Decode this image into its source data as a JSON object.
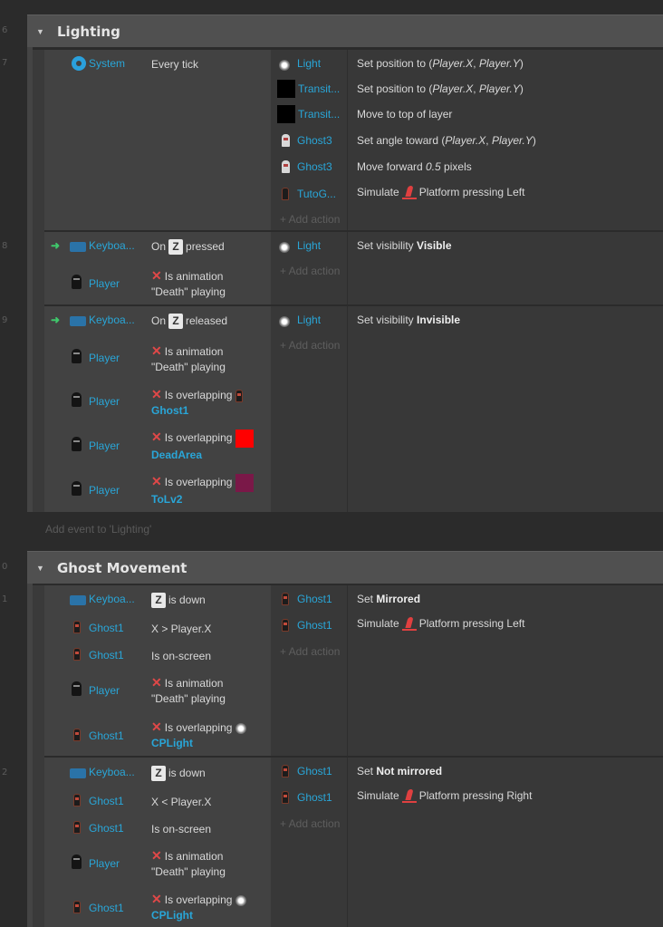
{
  "line_numbers": [
    "6",
    "7",
    "8",
    "9",
    "0",
    "1",
    "2"
  ],
  "groups": [
    {
      "title": "Lighting"
    },
    {
      "title": "Ghost Movement"
    }
  ],
  "add_event_label": "Add event to 'Lighting'",
  "add_action_label": "+ Add action",
  "events": {
    "e7": {
      "conds": [
        {
          "object": "System",
          "text": "Every tick"
        }
      ],
      "actions": [
        {
          "object": "Light",
          "text_html": "Set position to (<i>Player.X</i>, <i>Player.Y</i>)"
        },
        {
          "object": "Transit...",
          "text_html": "Set position to (<i>Player.X</i>, <i>Player.Y</i>)"
        },
        {
          "object": "Transit...",
          "text_html": "Move to top of layer"
        },
        {
          "object": "Ghost3",
          "text_html": "Set angle toward (<i>Player.X</i>, <i>Player.Y</i>)"
        },
        {
          "object": "Ghost3",
          "text_html": "Move forward <i>0.5</i> pixels"
        },
        {
          "object": "TutoG...",
          "pre": "Simulate",
          "post": "Platform pressing Left"
        }
      ]
    },
    "e8": {
      "conds": [
        {
          "object": "Keyboa...",
          "pre": "On",
          "key": "Z",
          "post": "pressed"
        },
        {
          "object": "Player",
          "line1": "Is animation",
          "line2": "\"Death\" playing"
        }
      ],
      "actions": [
        {
          "object": "Light",
          "pre": "Set visibility",
          "bold": "Visible"
        }
      ]
    },
    "e9": {
      "conds": [
        {
          "object": "Keyboa...",
          "pre": "On",
          "key": "Z",
          "post": "released"
        },
        {
          "object": "Player",
          "line1": "Is animation",
          "line2": "\"Death\" playing"
        },
        {
          "object": "Player",
          "line1": "Is overlapping",
          "line2": "Ghost1"
        },
        {
          "object": "Player",
          "line1": "Is overlapping",
          "line2": "DeadArea"
        },
        {
          "object": "Player",
          "line1": "Is overlapping",
          "line2": "ToLv2"
        }
      ],
      "actions": [
        {
          "object": "Light",
          "pre": "Set visibility",
          "bold": "Invisible"
        }
      ]
    },
    "e1": {
      "conds": [
        {
          "object": "Keyboa...",
          "key": "Z",
          "post": "is down"
        },
        {
          "object": "Ghost1",
          "text": "X > Player.X"
        },
        {
          "object": "Ghost1",
          "text": "Is on-screen"
        },
        {
          "object": "Player",
          "line1": "Is animation",
          "line2": "\"Death\" playing"
        },
        {
          "object": "Ghost1",
          "line1": "Is overlapping",
          "line2": "CPLight"
        }
      ],
      "actions": [
        {
          "object": "Ghost1",
          "pre": "Set",
          "bold": "Mirrored"
        },
        {
          "object": "Ghost1",
          "pre": "Simulate",
          "post": "Platform pressing Left"
        }
      ]
    },
    "e2": {
      "conds": [
        {
          "object": "Keyboa...",
          "key": "Z",
          "post": "is down"
        },
        {
          "object": "Ghost1",
          "text": "X < Player.X"
        },
        {
          "object": "Ghost1",
          "text": "Is on-screen"
        },
        {
          "object": "Player",
          "line1": "Is animation",
          "line2": "\"Death\" playing"
        },
        {
          "object": "Ghost1",
          "line1": "Is overlapping",
          "line2": "CPLight"
        }
      ],
      "actions": [
        {
          "object": "Ghost1",
          "pre": "Set",
          "bold": "Not mirrored"
        },
        {
          "object": "Ghost1",
          "pre": "Simulate",
          "post": "Platform pressing Right"
        }
      ]
    }
  }
}
